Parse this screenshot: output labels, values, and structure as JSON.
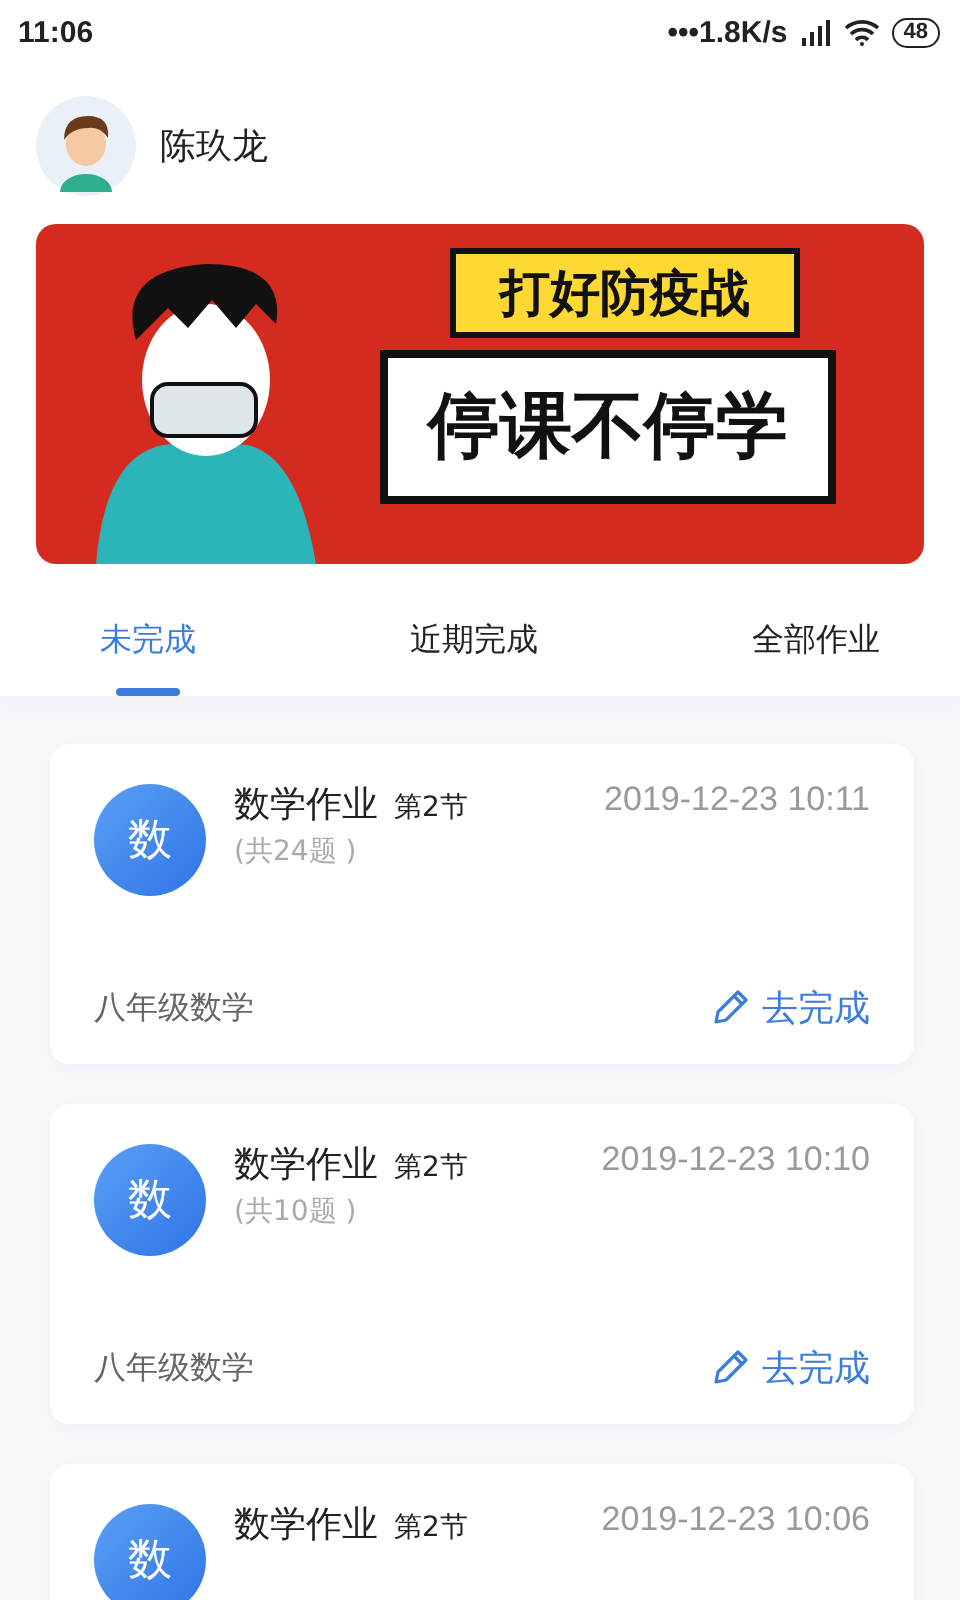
{
  "status_bar": {
    "time": "11:06",
    "network_speed": "•••1.8K/s",
    "battery": "48"
  },
  "user": {
    "name": "陈玖龙"
  },
  "banner": {
    "headline": "打好防疫战",
    "slogan": "停课不停学"
  },
  "tabs": [
    {
      "label": "未完成",
      "selected": true
    },
    {
      "label": "近期完成",
      "selected": false
    },
    {
      "label": "全部作业",
      "selected": false
    }
  ],
  "assignments": [
    {
      "badge": "数",
      "title": "数学作业",
      "section": "第2节",
      "date": "2019-12-23 10:11",
      "count": "(共24题 )",
      "course": "八年级数学",
      "action": "去完成"
    },
    {
      "badge": "数",
      "title": "数学作业",
      "section": "第2节",
      "date": "2019-12-23 10:10",
      "count": "(共10题 )",
      "course": "八年级数学",
      "action": "去完成"
    },
    {
      "badge": "数",
      "title": "数学作业",
      "section": "第2节",
      "date": "2019-12-23 10:06"
    }
  ]
}
